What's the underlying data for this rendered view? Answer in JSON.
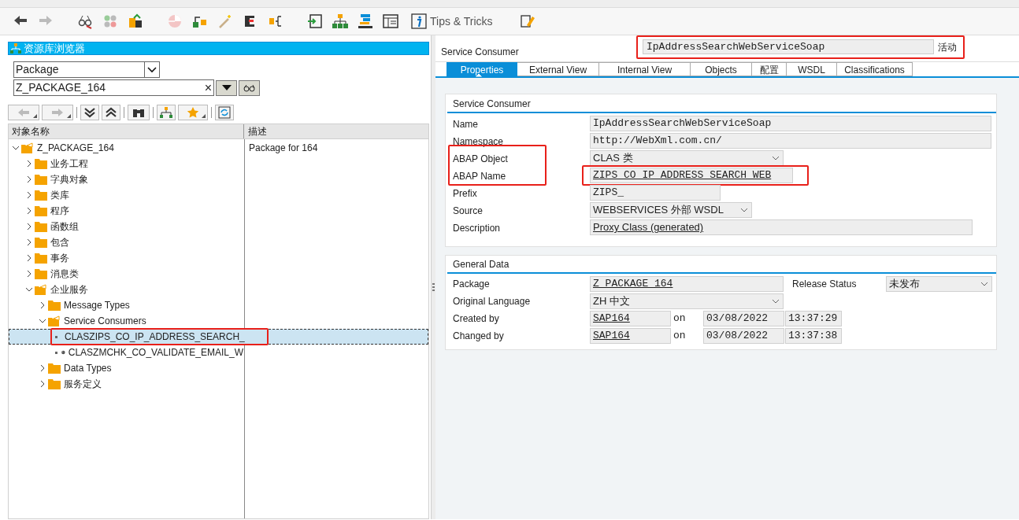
{
  "toolbar": {
    "tips_label": "Tips & Tricks",
    "forward_disabled": true
  },
  "browser": {
    "title": "资源库浏览器",
    "object_type": "Package",
    "object_name": "Z_PACKAGE_164",
    "clear_symbol": "×"
  },
  "tree": {
    "columns": [
      "对象名称",
      "描述"
    ],
    "nodes": [
      {
        "kind": "folder",
        "name": "Z_PACKAGE_164",
        "description": "Package for 164",
        "expanded": true,
        "selected": false,
        "children": [
          {
            "kind": "folder",
            "name": "业务工程",
            "expanded": false,
            "selected": false
          },
          {
            "kind": "folder",
            "name": "字典对象",
            "expanded": false,
            "selected": false
          },
          {
            "kind": "folder",
            "name": "类库",
            "expanded": false,
            "selected": false
          },
          {
            "kind": "folder",
            "name": "程序",
            "expanded": false,
            "selected": false
          },
          {
            "kind": "folder",
            "name": "函数组",
            "expanded": false,
            "selected": false
          },
          {
            "kind": "folder",
            "name": "包含",
            "expanded": false,
            "selected": false
          },
          {
            "kind": "folder",
            "name": "事务",
            "expanded": false,
            "selected": false
          },
          {
            "kind": "folder",
            "name": "消息类",
            "expanded": false,
            "selected": false
          },
          {
            "kind": "folder",
            "name": "企业服务",
            "expanded": true,
            "selected": false,
            "children": [
              {
                "kind": "folder",
                "name": "Message Types",
                "expanded": false,
                "selected": false
              },
              {
                "kind": "folder",
                "name": "Service Consumers",
                "expanded": true,
                "selected": false,
                "children": [
                  {
                    "kind": "object",
                    "name": "CLASZIPS_CO_IP_ADDRESS_SEARCH_",
                    "selected": true,
                    "highlighted": true
                  },
                  {
                    "kind": "object",
                    "name": "CLASZMCHK_CO_VALIDATE_EMAIL_W",
                    "selected": false
                  }
                ]
              },
              {
                "kind": "folder",
                "name": "Data Types",
                "expanded": false,
                "selected": false
              },
              {
                "kind": "folder",
                "name": "服务定义",
                "expanded": false,
                "selected": false
              }
            ]
          }
        ]
      }
    ]
  },
  "header": {
    "label": "Service Consumer",
    "value": "IpAddressSearchWebServiceSoap",
    "status": "活动",
    "highlighted": true
  },
  "tabs": [
    {
      "label": "Properties",
      "selected": true
    },
    {
      "label": "External View",
      "selected": false
    },
    {
      "label": "Internal View",
      "selected": false
    },
    {
      "label": "Objects",
      "selected": false
    },
    {
      "label": "配置",
      "selected": false
    },
    {
      "label": "WSDL",
      "selected": false
    },
    {
      "label": "Classifications",
      "selected": false
    }
  ],
  "service_consumer": {
    "title": "Service Consumer",
    "fields": [
      {
        "label": "Name",
        "value": "IpAddressSearchWebServiceSoap",
        "kind": "mono"
      },
      {
        "label": "Namespace",
        "value": "http://WebXml.com.cn/",
        "kind": "mono"
      },
      {
        "label": "ABAP Object",
        "value": "CLAS 类",
        "kind": "dropdown",
        "label_highlighted": true
      },
      {
        "label": "ABAP Name",
        "value": "ZIPS_CO_IP_ADDRESS_SEARCH_WEB",
        "kind": "link",
        "highlighted": true,
        "label_highlighted": true
      },
      {
        "label": "Prefix",
        "value": "ZIPS_",
        "kind": "mono"
      },
      {
        "label": "Source",
        "value": "WEBSERVICES 外部 WSDL",
        "kind": "dropdown"
      },
      {
        "label": "Description",
        "value": "Proxy Class (generated)",
        "kind": "textlink"
      }
    ]
  },
  "general_data": {
    "title": "General Data",
    "package": {
      "label": "Package",
      "value": "Z_PACKAGE_164"
    },
    "release_status": {
      "label": "Release Status",
      "value": "未发布"
    },
    "language": {
      "label": "Original Language",
      "value": "ZH 中文"
    },
    "history": [
      {
        "label": "Created by",
        "user": "SAP164",
        "on": "on",
        "date": "03/08/2022",
        "time": "13:37:29"
      },
      {
        "label": "Changed by",
        "user": "SAP164",
        "on": "on",
        "date": "03/08/2022",
        "time": "13:37:38"
      }
    ]
  }
}
